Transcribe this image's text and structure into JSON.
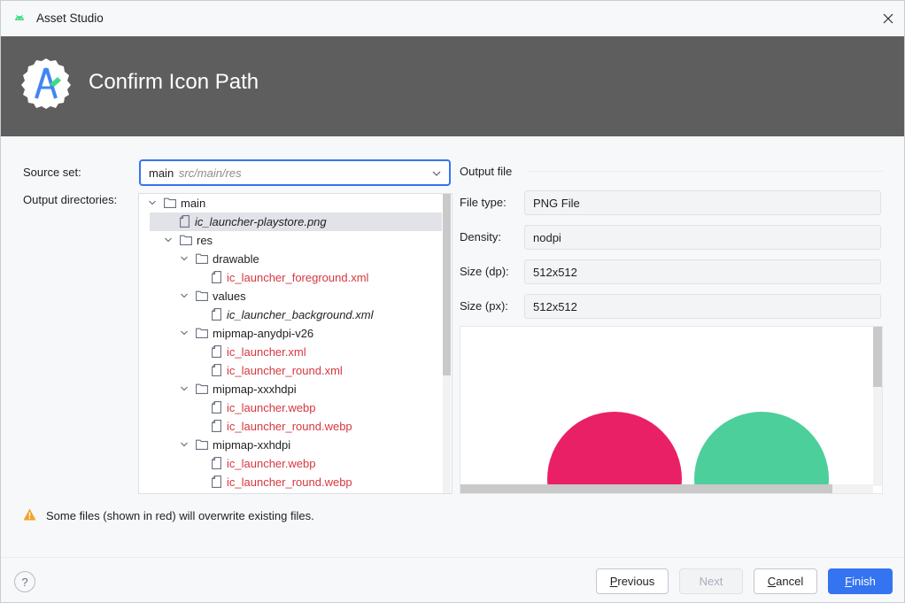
{
  "window": {
    "title": "Asset Studio"
  },
  "banner": {
    "heading": "Confirm Icon Path"
  },
  "form": {
    "source_set_label": "Source set:",
    "source_set_value": "main",
    "source_set_hint": "src/main/res",
    "output_dirs_label": "Output directories:"
  },
  "tree": {
    "rows": [
      {
        "label": "main",
        "kind": "folder",
        "depth": 0,
        "expanded": true,
        "overwrite": false
      },
      {
        "label": "ic_launcher-playstore.png",
        "kind": "file",
        "depth": 1,
        "overwrite": false,
        "selected": true
      },
      {
        "label": "res",
        "kind": "folder",
        "depth": 1,
        "expanded": true,
        "overwrite": false
      },
      {
        "label": "drawable",
        "kind": "folder",
        "depth": 2,
        "expanded": true,
        "overwrite": false
      },
      {
        "label": "ic_launcher_foreground.xml",
        "kind": "file",
        "depth": 3,
        "overwrite": true
      },
      {
        "label": "values",
        "kind": "folder",
        "depth": 2,
        "expanded": true,
        "overwrite": false
      },
      {
        "label": "ic_launcher_background.xml",
        "kind": "file",
        "depth": 3,
        "overwrite": false
      },
      {
        "label": "mipmap-anydpi-v26",
        "kind": "folder",
        "depth": 2,
        "expanded": true,
        "overwrite": false
      },
      {
        "label": "ic_launcher.xml",
        "kind": "file",
        "depth": 3,
        "overwrite": true
      },
      {
        "label": "ic_launcher_round.xml",
        "kind": "file",
        "depth": 3,
        "overwrite": true
      },
      {
        "label": "mipmap-xxxhdpi",
        "kind": "folder",
        "depth": 2,
        "expanded": true,
        "overwrite": false
      },
      {
        "label": "ic_launcher.webp",
        "kind": "file",
        "depth": 3,
        "overwrite": true
      },
      {
        "label": "ic_launcher_round.webp",
        "kind": "file",
        "depth": 3,
        "overwrite": true
      },
      {
        "label": "mipmap-xxhdpi",
        "kind": "folder",
        "depth": 2,
        "expanded": true,
        "overwrite": false
      },
      {
        "label": "ic_launcher.webp",
        "kind": "file",
        "depth": 3,
        "overwrite": true
      },
      {
        "label": "ic_launcher_round.webp",
        "kind": "file",
        "depth": 3,
        "overwrite": true
      }
    ]
  },
  "output_file": {
    "section_title": "Output file",
    "file_type_label": "File type:",
    "file_type_value": "PNG File",
    "density_label": "Density:",
    "density_value": "nodpi",
    "size_dp_label": "Size (dp):",
    "size_dp_value": "512x512",
    "size_px_label": "Size (px):",
    "size_px_value": "512x512"
  },
  "warning": {
    "text": "Some files (shown in red) will overwrite existing files."
  },
  "buttons": {
    "help": "?",
    "previous": "Previous",
    "next": "Next",
    "cancel": "Cancel",
    "finish": "Finish"
  },
  "colors": {
    "accent": "#3574f0",
    "overwrite_text": "#d6373f",
    "banner_bg": "#5e5e5e",
    "preview_pink": "#ea2066",
    "preview_green": "#4ccf9b",
    "warning_icon": "#f2a428"
  },
  "icons": {
    "app": "android-icon",
    "logo": "android-studio-logo",
    "close": "close-icon",
    "dropdown": "chevron-down-icon",
    "folder": "folder-icon",
    "file": "file-icon",
    "warning": "warning-icon",
    "help": "help-icon"
  }
}
